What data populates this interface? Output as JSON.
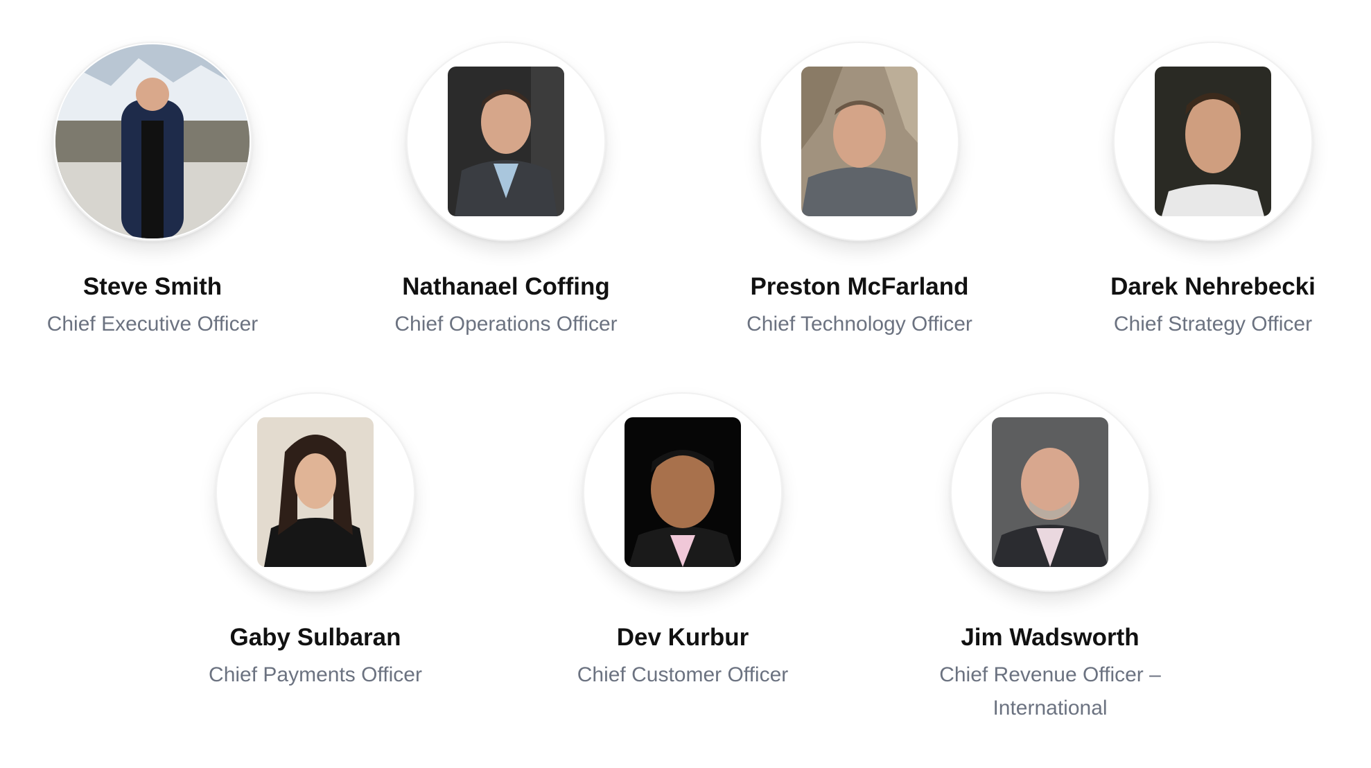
{
  "team": [
    {
      "name": "Steve Smith",
      "title": "Chief Executive Officer",
      "photo": "photo-outdoor-mountains"
    },
    {
      "name": "Nathanael Coffing",
      "title": "Chief Operations Officer",
      "photo": "photo-dark-studio"
    },
    {
      "name": "Preston McFarland",
      "title": "Chief Technology Officer",
      "photo": "photo-rock-outdoor"
    },
    {
      "name": "Darek Nehrebecki",
      "title": "Chief Strategy Officer",
      "photo": "photo-dark-studio"
    },
    {
      "name": "Gaby Sulbaran",
      "title": "Chief Payments Officer",
      "photo": "photo-light-wall"
    },
    {
      "name": "Dev Kurbur",
      "title": "Chief Customer Officer",
      "photo": "photo-black-background"
    },
    {
      "name": "Jim Wadsworth",
      "title": "Chief Revenue Officer – International",
      "photo": "photo-grey-studio"
    }
  ]
}
